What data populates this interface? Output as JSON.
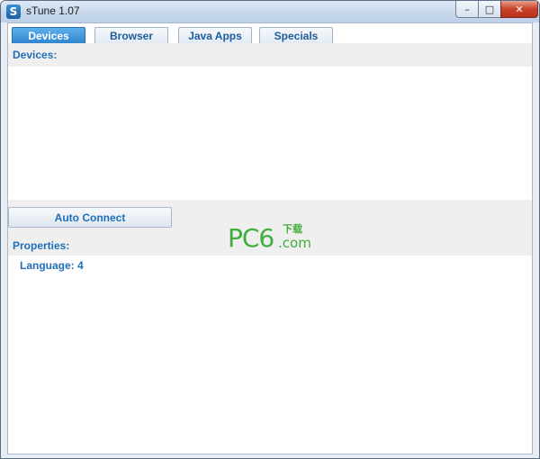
{
  "window": {
    "title": "sTune 1.07",
    "icon_letter": "S",
    "controls": {
      "minimize": "–",
      "maximize": "□",
      "close": "✕"
    }
  },
  "tabs": [
    {
      "label": "Devices",
      "active": true
    },
    {
      "label": "Browser",
      "active": false
    },
    {
      "label": "Java Apps",
      "active": false
    },
    {
      "label": "Specials",
      "active": false
    }
  ],
  "devices": {
    "heading": "Devices:",
    "items": []
  },
  "actions": {
    "auto_connect": "Auto Connect"
  },
  "properties": {
    "heading": "Properties:",
    "rows": [
      {
        "text": "Language: 4"
      }
    ]
  },
  "watermark": {
    "main": "PC6",
    "cn": "下载",
    "suffix": ".com"
  },
  "colors": {
    "accent": "#1f6fb8",
    "tab_active": "#2f86d0",
    "watermark": "#3fae3a"
  }
}
